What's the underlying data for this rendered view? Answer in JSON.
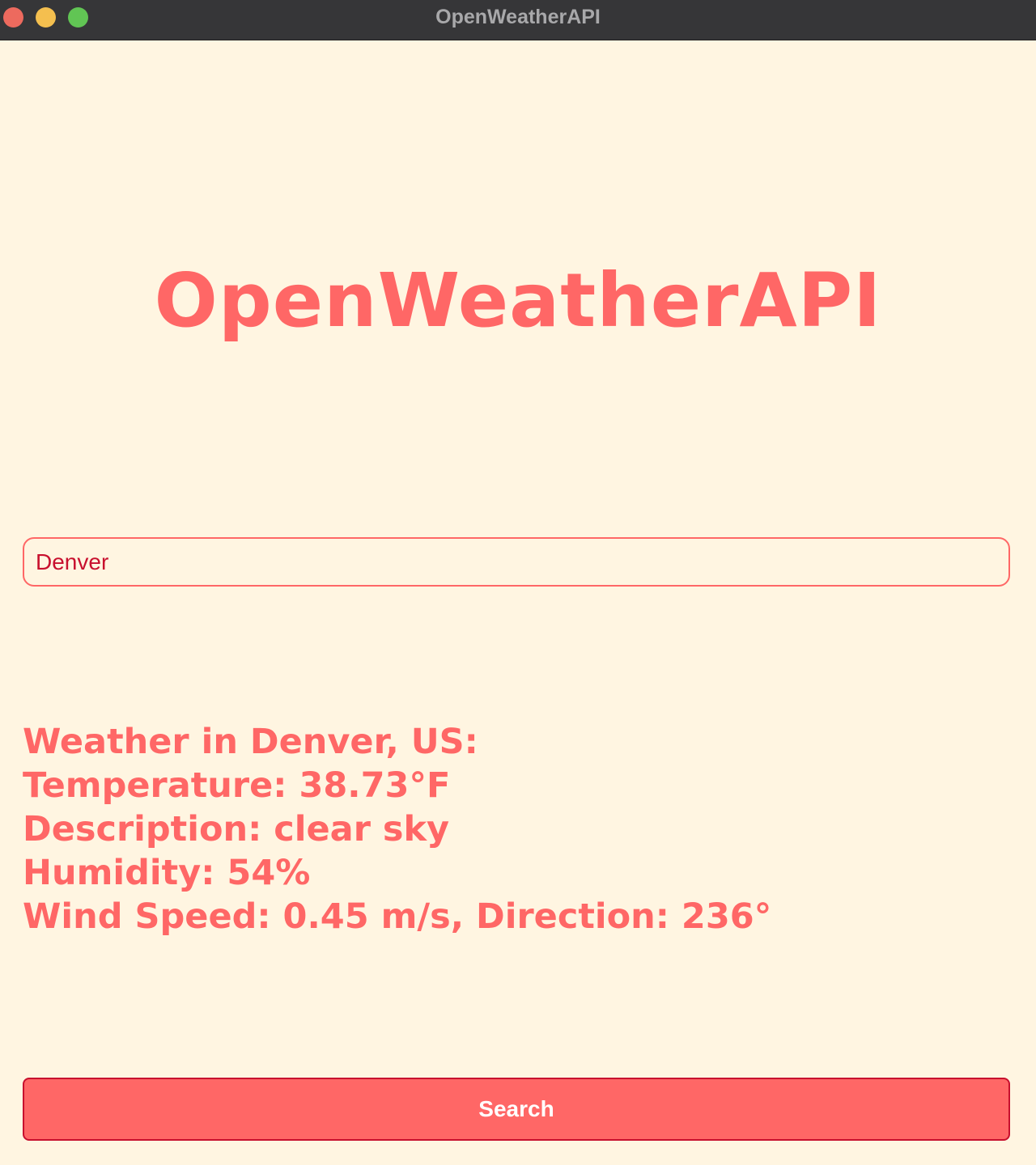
{
  "window": {
    "title": "OpenWeatherAPI"
  },
  "app": {
    "heading": "OpenWeatherAPI"
  },
  "search": {
    "value": "Denver"
  },
  "results": {
    "location_line": "Weather in Denver, US:",
    "temperature_line": "Temperature: 38.73°F",
    "description_line": "Description: clear sky",
    "humidity_line": "Humidity: 54%",
    "wind_line": "Wind Speed: 0.45 m/s, Direction: 236°"
  },
  "button": {
    "label": "Search"
  },
  "colors": {
    "background": "#fff5e1",
    "accent": "#ff6766",
    "input_text": "#c8102e",
    "button_border": "#c8102e",
    "titlebar": "#363638"
  }
}
